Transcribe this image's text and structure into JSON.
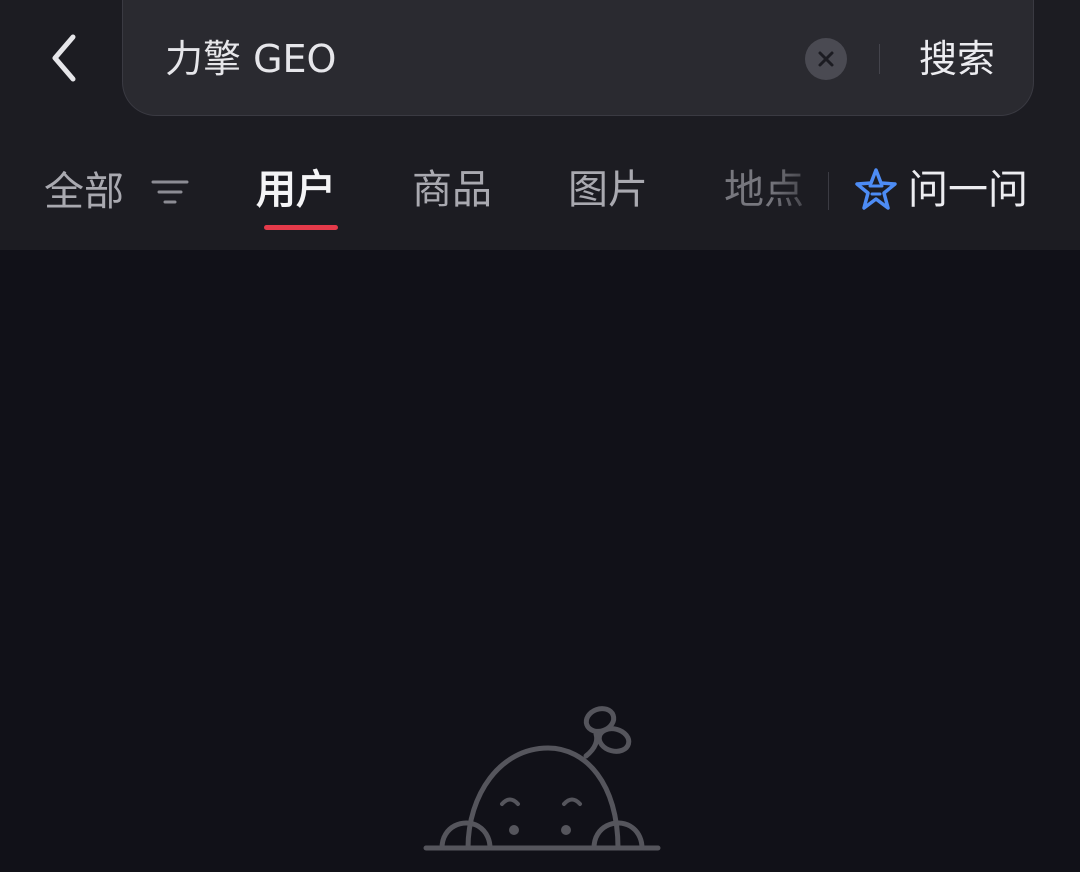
{
  "search": {
    "value": "力擎 GEO",
    "button_label": "搜索"
  },
  "tabs": [
    {
      "label": "全部",
      "selected": false
    },
    {
      "label": "用户",
      "selected": true
    },
    {
      "label": "商品",
      "selected": false
    },
    {
      "label": "图片",
      "selected": false
    },
    {
      "label": "地点",
      "selected": false
    }
  ],
  "ask": {
    "label": "问一问"
  },
  "icons": {
    "back": "chevron-left-icon",
    "clear": "close-icon",
    "filter": "filter-icon",
    "ask": "star-spark-icon",
    "empty": "empty-state-illustration"
  },
  "colors": {
    "background": "#111118",
    "topbar": "#1c1c22",
    "accent": "#e43a4a",
    "ask_icon": "#4d8cf5"
  }
}
